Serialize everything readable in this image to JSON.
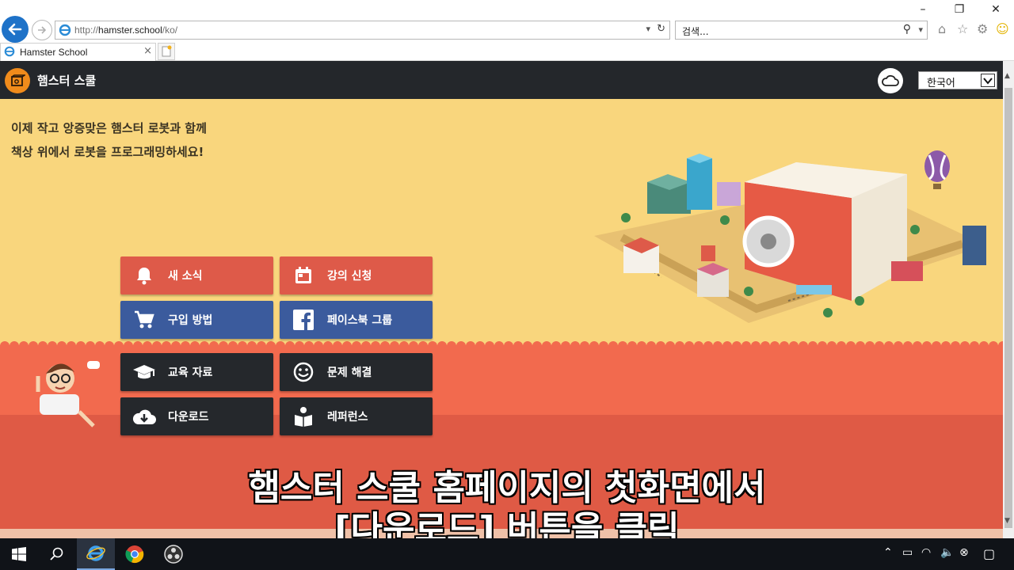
{
  "browser": {
    "url_prefix": "http://",
    "url_host": "hamster.school",
    "url_path": "/ko/",
    "search_placeholder": "검색...",
    "tab_title": "Hamster School",
    "tab_close": "×"
  },
  "site": {
    "logo_text": "햄스터 스쿨",
    "language": "한국어",
    "intro_line1": "이제 작고 앙증맞은 햄스터 로봇과 함께",
    "intro_line2": "책상 위에서 로봇을 프로그래밍하세요!"
  },
  "menu": [
    {
      "label": "새 소식",
      "icon": "bell-icon",
      "color": "#de5a49"
    },
    {
      "label": "강의 신청",
      "icon": "calendar-icon",
      "color": "#de5a49"
    },
    {
      "label": "구입 방법",
      "icon": "cart-icon",
      "color": "#3b5b9d"
    },
    {
      "label": "페이스북 그룹",
      "icon": "facebook-icon",
      "color": "#3b5b9d"
    },
    {
      "label": "교육 자료",
      "icon": "graduation-cap-icon",
      "color": "#25282c"
    },
    {
      "label": "문제 해결",
      "icon": "smiley-icon",
      "color": "#25282c"
    },
    {
      "label": "다운로드",
      "icon": "cloud-download-icon",
      "color": "#25282c"
    },
    {
      "label": "레퍼런스",
      "icon": "book-reader-icon",
      "color": "#25282c"
    }
  ],
  "subtitle": {
    "line1": "햄스터 스쿨 홈페이지의 첫화면에서",
    "line2": "[다운로드] 버튼을 클릭"
  }
}
